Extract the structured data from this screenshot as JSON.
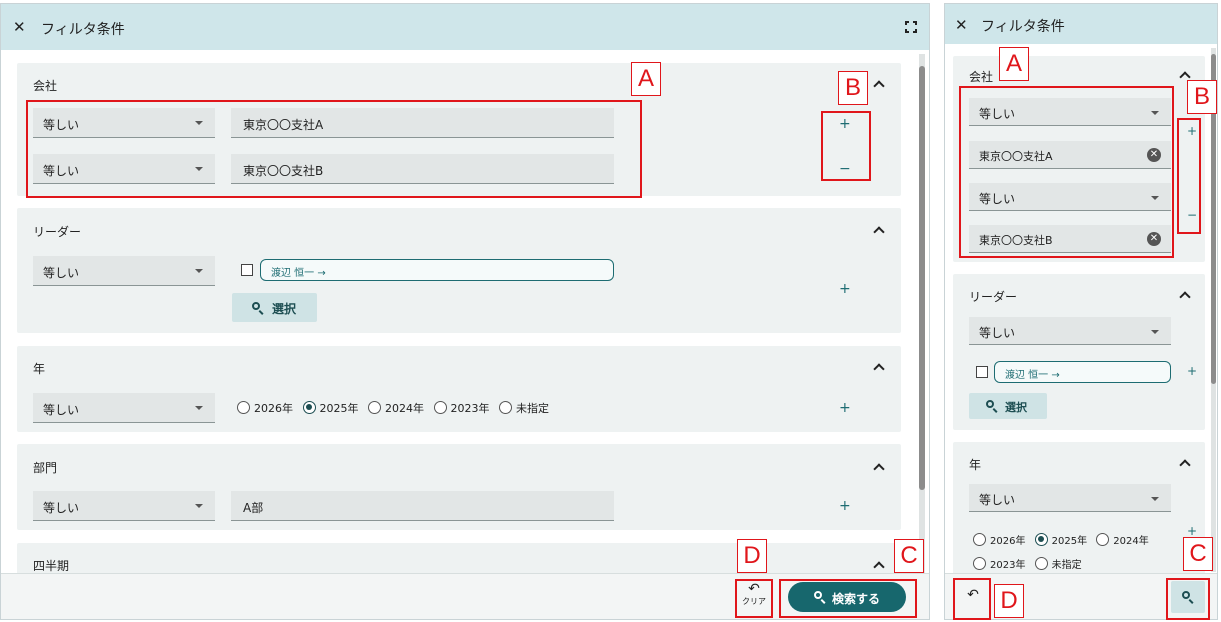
{
  "dialog": {
    "title": "フィルタ条件"
  },
  "sections": {
    "company": {
      "title": "会社",
      "operator": "等しい",
      "values": [
        "東京〇〇支社A",
        "東京〇〇支社B"
      ]
    },
    "leader": {
      "title": "リーダー",
      "operator": "等しい",
      "chip": "渡辺 恒一 →",
      "select_label": "選択"
    },
    "year": {
      "title": "年",
      "operator": "等しい",
      "options": [
        "2026年",
        "2025年",
        "2024年",
        "2023年",
        "未指定"
      ],
      "selected": "2025年"
    },
    "dept": {
      "title": "部門",
      "operator": "等しい",
      "value": "A部"
    },
    "quarter": {
      "title": "四半期"
    }
  },
  "buttons": {
    "add": "+",
    "remove": "−",
    "clear_glyph": "↶",
    "clear_label": "クリア",
    "search_label": "検索する",
    "clear_value_glyph": "✕"
  },
  "annotations": {
    "a": "A",
    "b": "B",
    "c": "C",
    "d": "D"
  },
  "colors": {
    "header": "#cfe6ea",
    "section": "#eef2f2",
    "accent": "#17676d",
    "annotation": "#e0161b"
  },
  "icons": [
    "close-icon",
    "expand-icon",
    "chevron-up-icon",
    "search-icon",
    "undo-icon",
    "clear-value-icon"
  ]
}
